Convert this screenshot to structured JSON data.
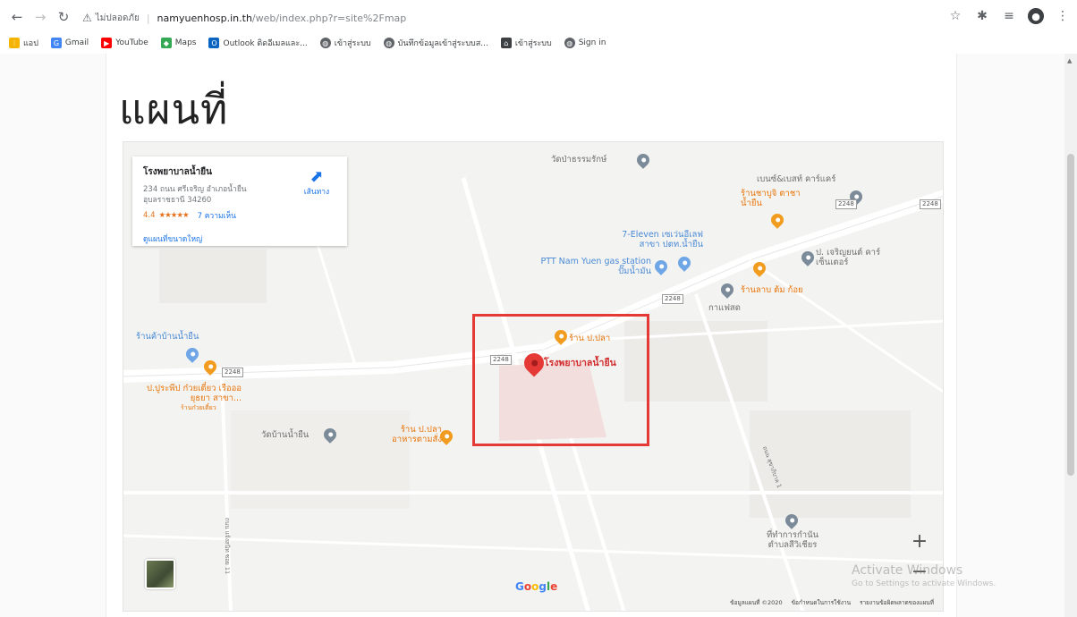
{
  "browser": {
    "security_label": "ไม่ปลอดภัย",
    "url_host": "namyuenhosp.in.th",
    "url_path": "/web/index.php?r=site%2Fmap"
  },
  "bookmarks": [
    {
      "label": "แอป",
      "icon": "apps-grid-icon",
      "color": "#f4b400"
    },
    {
      "label": "Gmail",
      "icon": "google-g-icon",
      "color": "#4285f4"
    },
    {
      "label": "YouTube",
      "icon": "youtube-icon",
      "color": "#ff0000"
    },
    {
      "label": "Maps",
      "icon": "maps-icon",
      "color": "#34a853"
    },
    {
      "label": "Outlook ติดอีเมลและ...",
      "icon": "outlook-icon",
      "color": "#0a64c2"
    },
    {
      "label": "เข้าสู่ระบบ",
      "icon": "globe-icon",
      "color": "#5f6368"
    },
    {
      "label": "บันทึกข้อมูลเข้าสู่ระบบส...",
      "icon": "globe-icon",
      "color": "#5f6368"
    },
    {
      "label": "เข้าสู่ระบบ",
      "icon": "home-icon",
      "color": "#3c4043"
    },
    {
      "label": "Sign in",
      "icon": "globe-icon",
      "color": "#5f6368"
    }
  ],
  "page": {
    "title": "แผนที่"
  },
  "map": {
    "info_card": {
      "name": "โรงพยาบาลน้ำยืน",
      "address": "234 ถนน ศรีเจริญ อำเภอน้ำยืน อุบลราชธานี 34260",
      "rating": "4.4",
      "stars": "★★★★★",
      "reviews": "7 ความเห็น",
      "larger_map": "ดูแผนที่ขนาดใหญ่",
      "directions": "เส้นทาง"
    },
    "pois": [
      {
        "label": "วัดป่าธรรมรักษ์",
        "style": "gray"
      },
      {
        "label": "เบนซ์&เบสท์ คาร์แคร์",
        "style": "gray"
      },
      {
        "label": "ร้านชาบูจิ ตาชาน้ำยืน",
        "style": "orange"
      },
      {
        "label": "7-Eleven เซเว่นอีเลฟ สาขา ปตท.น้ำยืน",
        "style": "blue"
      },
      {
        "label": "PTT Nam Yuen gas station ปั๊มน้ำมัน",
        "style": "blue"
      },
      {
        "label": "ป. เจริญยนต์ คาร์เซ็นเตอร์",
        "style": "gray"
      },
      {
        "label": "ร้านลาบ ต้ม ก้อย",
        "style": "orange"
      },
      {
        "label": "กาแฟสด",
        "style": "gray"
      },
      {
        "label": "ร้านค้าบ้านน้ำยืน",
        "style": "blue"
      },
      {
        "label": "ร้าน ป.ปลา",
        "style": "orange"
      },
      {
        "label": "โรงพยาบาลน้ำยืน",
        "style": "red"
      },
      {
        "label": "ป.ปูระพีป ก๋วยเตี๋ยว เรือออยุธยา สาขา...",
        "style": "orange"
      },
      {
        "label": "ร้านก๋วยเตี๋ยว",
        "style": "orange"
      },
      {
        "label": "วัดบ้านน้ำยืน",
        "style": "gray"
      },
      {
        "label": "ร้าน ป.ปลา อาหารตามสั่ง",
        "style": "orange"
      },
      {
        "label": "ที่ทำการกำนัน ตำบลสีวิเชียร",
        "style": "gray"
      }
    ],
    "road_shields": [
      "2248",
      "2248",
      "2248",
      "2248",
      "2248",
      "2248"
    ],
    "road_labels": [
      "ถนน สุขาภิบาล 1",
      "ถนน แจ้งสนิท ซอย 11"
    ],
    "zoom_in": "+",
    "zoom_out": "−",
    "google_logo": [
      "G",
      "o",
      "o",
      "g",
      "l",
      "e"
    ],
    "attribution": [
      "ข้อมูลแผนที่ ©2020",
      "ข้อกำหนดในการใช้งาน",
      "รายงานข้อผิดพลาดของแผนที่"
    ]
  },
  "watermark": {
    "line1": "Activate Windows",
    "line2": "Go to Settings to activate Windows."
  }
}
